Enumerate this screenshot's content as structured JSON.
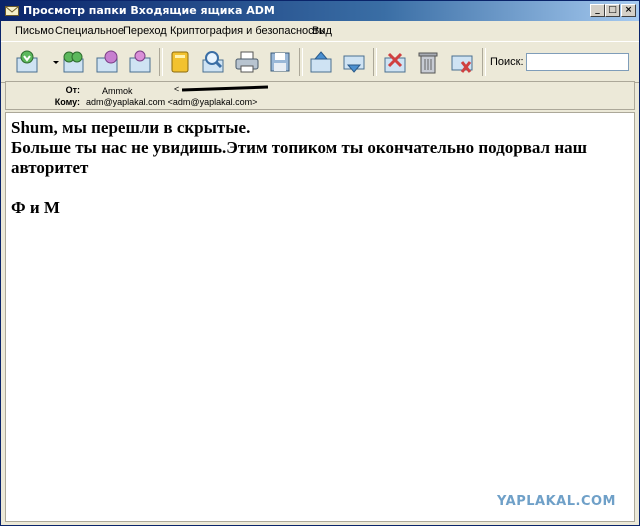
{
  "window": {
    "title": "Просмотр папки Входящие ящика ADM",
    "controls": {
      "minimize": "_",
      "maximize": "□",
      "close": "×"
    }
  },
  "menu": {
    "items": [
      "Письмо",
      "Специальное",
      "Переход",
      "Криптография и безопасность",
      "Вид"
    ]
  },
  "toolbar": {
    "search_label": "Поиск:",
    "search_value": ""
  },
  "header": {
    "from_label": "От:",
    "from_value": "Ammok",
    "from_bracket": "<",
    "to_label": "Кому:",
    "to_value": "adm@yaplakal.com <adm@yaplakal.com>"
  },
  "message": {
    "line1": "Shum, мы перешли в скрытые.",
    "line2": "Больше ты нас не увидишь.Этим топиком ты окончательно подорвал наш авторитет",
    "signature": "Ф и М"
  },
  "watermark": "YAPLAKAL.COM",
  "colors": {
    "titlebar": "#0a246a",
    "accent": "#3a6ea5",
    "watermark": "#6fa0c8"
  }
}
